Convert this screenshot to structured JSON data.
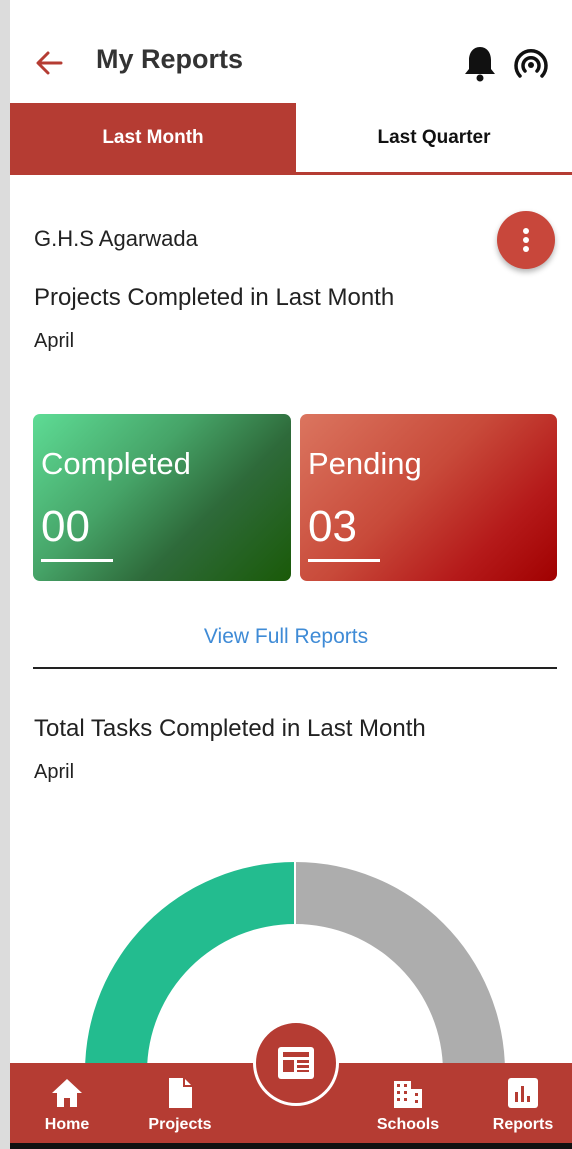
{
  "header": {
    "title": "My Reports",
    "icons": [
      "back-arrow-icon",
      "bell-icon",
      "radar-icon"
    ]
  },
  "tabs": [
    {
      "label": "Last Month",
      "active": true
    },
    {
      "label": "Last Quarter",
      "active": false
    }
  ],
  "school": {
    "name": "G.H.S Agarwada"
  },
  "projects": {
    "title": "Projects Completed in Last Month",
    "month": "April",
    "completed_label": "Completed",
    "completed_value": "00",
    "pending_label": "Pending",
    "pending_value": "03",
    "view_link": "View Full Reports"
  },
  "tasks": {
    "title": "Total Tasks Completed in Last Month",
    "month": "April"
  },
  "chart_data": {
    "type": "pie",
    "shape": "semi-donut",
    "slices": [
      {
        "color": "#23bc8f",
        "fraction": 0.5
      },
      {
        "color": "#adadad",
        "fraction": 0.5
      }
    ]
  },
  "bottom_nav": {
    "items": [
      {
        "label": "Home",
        "icon": "home-icon"
      },
      {
        "label": "Projects",
        "icon": "document-icon"
      },
      {
        "label": "Schools",
        "icon": "building-icon"
      },
      {
        "label": "Reports",
        "icon": "bar-chart-icon"
      }
    ],
    "center_icon": "newspaper-icon"
  },
  "colors": {
    "primary": "#b53c33",
    "link": "#3f8bd6",
    "completed": "#23bc8f",
    "pending": "#adadad"
  }
}
